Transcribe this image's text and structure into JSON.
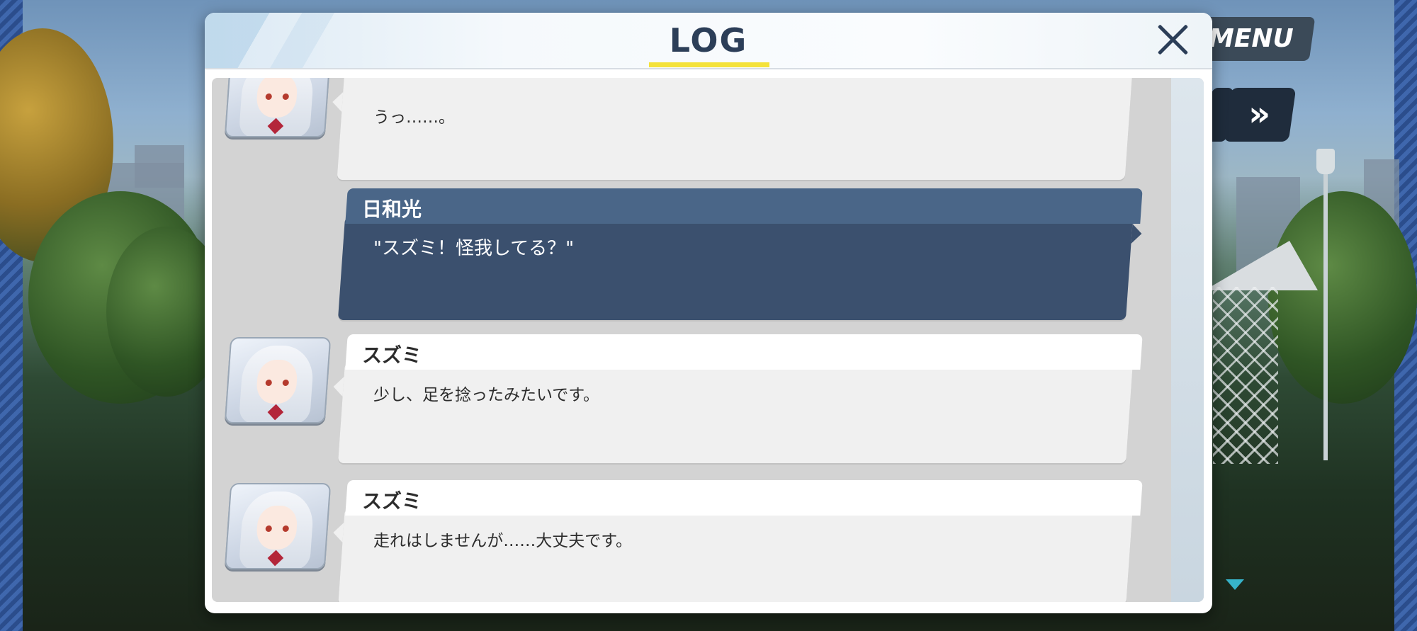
{
  "hud": {
    "menu_label": "MENU",
    "skip_label": "»"
  },
  "log": {
    "title": "LOG",
    "close_label": "",
    "entries": [
      {
        "speaker": "",
        "text": "うっ……。",
        "is_player": false
      },
      {
        "speaker": "日和光",
        "text": "\"スズミ！怪我してる？\"",
        "is_player": true
      },
      {
        "speaker": "スズミ",
        "text": "少し、足を捻ったみたいです。",
        "is_player": false
      },
      {
        "speaker": "スズミ",
        "text": "走れはしませんが……大丈夫です。",
        "is_player": false
      }
    ]
  },
  "colors": {
    "title": "#2c3e58",
    "title_underline": "#f4e23a",
    "player_bubble": "#3b506e",
    "player_name_bar": "#4a6688",
    "npc_bubble": "#f0f0f0",
    "next_arrow": "#37b3c9"
  }
}
